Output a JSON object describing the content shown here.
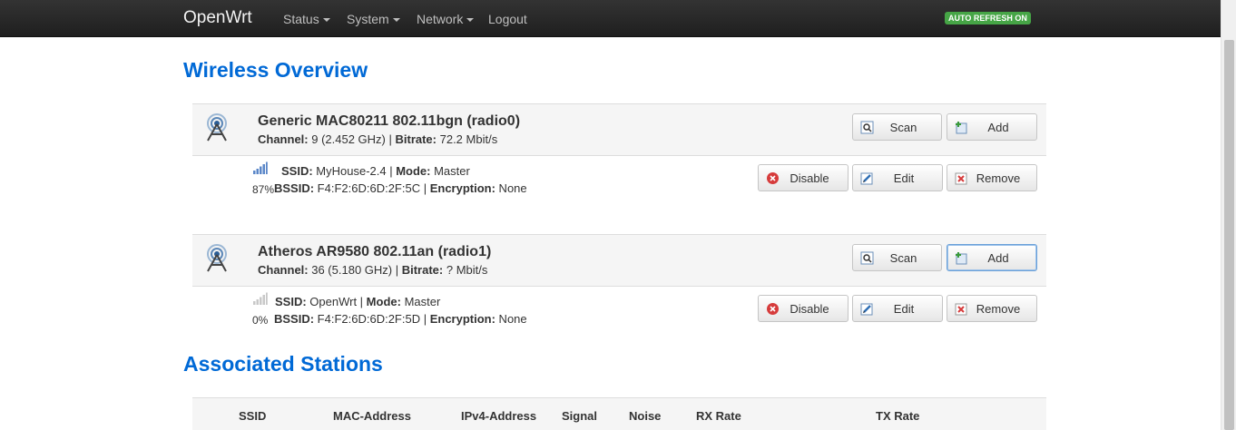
{
  "navbar": {
    "brand": "OpenWrt",
    "menu": [
      {
        "label": "Status"
      },
      {
        "label": "System"
      },
      {
        "label": "Network"
      },
      {
        "label": "Logout"
      }
    ],
    "auto_refresh": "AUTO REFRESH ON"
  },
  "overview_title": "Wireless Overview",
  "radios": [
    {
      "title": "Generic MAC80211 802.11bgn (radio0)",
      "channel_label": "Channel:",
      "channel": " 9 (2.452 GHz) | ",
      "bitrate_label": "Bitrate:",
      "bitrate": " 72.2 Mbit/s",
      "buttons": {
        "scan": "Scan",
        "add": "Add"
      },
      "network": {
        "signal_pct": "87%",
        "signal_level": 0.87,
        "ssid_label": "SSID:",
        "ssid": " MyHouse-2.4 | ",
        "mode_label": "Mode:",
        "mode": " Master",
        "bssid_label": "BSSID:",
        "bssid": " F4:F2:6D:6D:2F:5C | ",
        "enc_label": "Encryption:",
        "enc": " None",
        "buttons": {
          "disable": "Disable",
          "edit": "Edit",
          "remove": "Remove"
        }
      }
    },
    {
      "title": "Atheros AR9580 802.11an (radio1)",
      "channel_label": "Channel:",
      "channel": " 36 (5.180 GHz) | ",
      "bitrate_label": "Bitrate:",
      "bitrate": " ? Mbit/s",
      "buttons": {
        "scan": "Scan",
        "add": "Add"
      },
      "network": {
        "signal_pct": "0%",
        "signal_level": 0,
        "ssid_label": "SSID:",
        "ssid": " OpenWrt | ",
        "mode_label": "Mode:",
        "mode": " Master",
        "bssid_label": "BSSID:",
        "bssid": " F4:F2:6D:6D:2F:5D | ",
        "enc_label": "Encryption:",
        "enc": " None",
        "buttons": {
          "disable": "Disable",
          "edit": "Edit",
          "remove": "Remove"
        }
      }
    }
  ],
  "stations_title": "Associated Stations",
  "stations_columns": [
    "SSID",
    "MAC-Address",
    "IPv4-Address",
    "Signal",
    "Noise",
    "RX Rate",
    "TX Rate"
  ],
  "colors": {
    "accent": "#0069d6",
    "badge": "#46a546"
  }
}
